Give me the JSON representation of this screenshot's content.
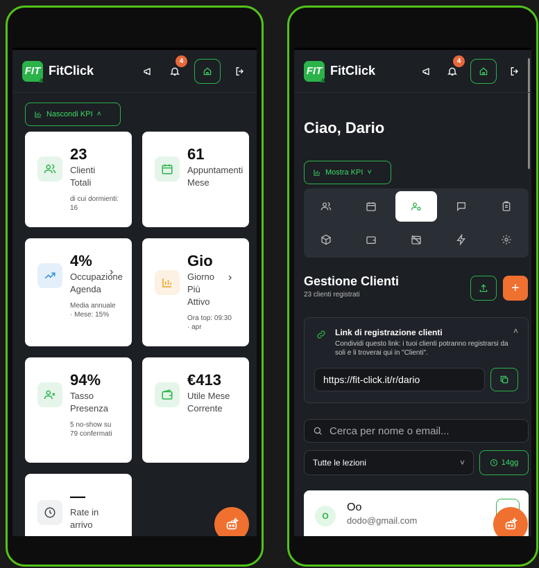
{
  "app": {
    "brand": "FitClick",
    "logo_text": "FIT",
    "notification_count": "4"
  },
  "left": {
    "kpi_toggle": "Nascondi KPI",
    "cards": [
      {
        "value": "23",
        "label": "Clienti Totali",
        "sub": "di cui dormienti: 16",
        "icon": "users-icon"
      },
      {
        "value": "61",
        "label": "Appuntamenti Mese",
        "sub": "",
        "icon": "calendar-icon"
      },
      {
        "value": "4%",
        "label": "Occupazione Agenda",
        "sub": "Media annuale · Mese: 15%",
        "icon": "trend-up-icon"
      },
      {
        "value": "Gio",
        "label": "Giorno Più Attivo",
        "sub": "Ora top: 09:30 · apr",
        "icon": "bar-chart-icon"
      },
      {
        "value": "94%",
        "label": "Tasso Presenza",
        "sub": "5 no-show su 79 confermati",
        "icon": "user-x-icon"
      },
      {
        "value": "€413",
        "label": "Utile Mese Corrente",
        "sub": "",
        "icon": "wallet-icon"
      },
      {
        "value": "—",
        "label": "Rate in arrivo",
        "sub": "",
        "icon": "clock-icon"
      }
    ]
  },
  "right": {
    "greeting": "Ciao, Dario",
    "kpi_toggle": "Mostra KPI",
    "section_title": "Gestione Clienti",
    "section_sub": "23 clienti registrati",
    "link_title": "Link di registrazione clienti",
    "link_desc": "Condividi questo link: i tuoi clienti potranno registrarsi da soli e li troverai qui in \"Clienti\".",
    "link_url": "https://fit-click.it/r/dario",
    "search_placeholder": "Cerca per nome o email...",
    "filter_value": "Tutte le lezioni",
    "days_button": "14gg",
    "client": {
      "initial": "O",
      "name": "Oo",
      "email": "dodo@gmail.com"
    }
  },
  "colors": {
    "accent": "#2bb34a",
    "orange": "#f07030",
    "dark": "#1c1f24"
  }
}
